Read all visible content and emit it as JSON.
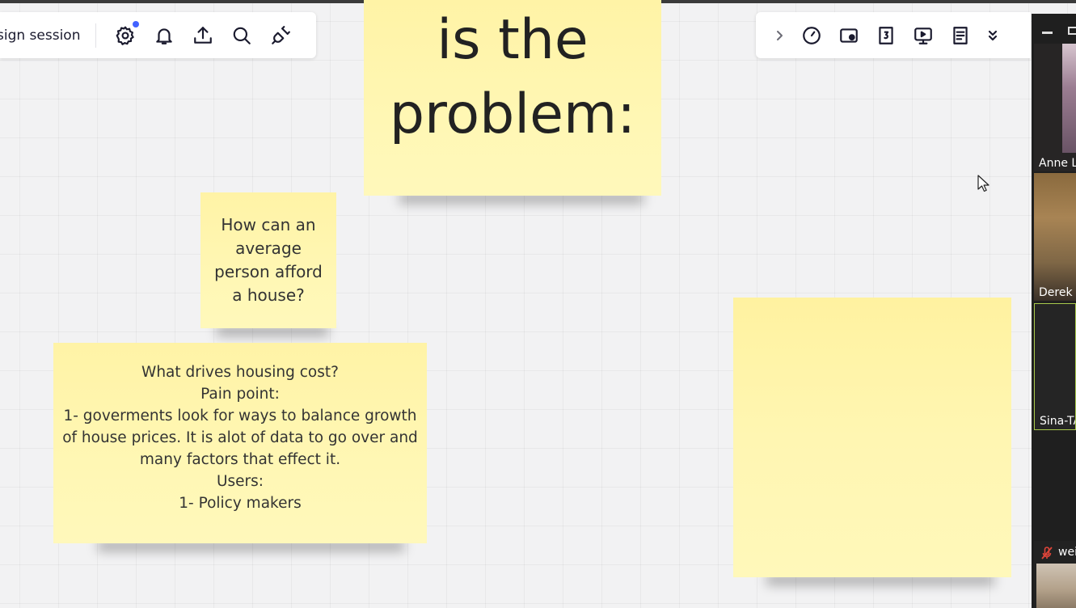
{
  "toolbar_left": {
    "session_label": "sign session",
    "icons": [
      "settings-icon",
      "bell-icon",
      "upload-icon",
      "search-icon",
      "plug-icon"
    ],
    "notification_dot_color": "#4262ff"
  },
  "toolbar_right": {
    "icons": [
      "chevron-right-icon",
      "timer-icon",
      "present-icon",
      "counter-icon",
      "screen-share-icon",
      "notes-icon",
      "chevrons-down-icon"
    ]
  },
  "stickies": {
    "title_lines": [
      "is the",
      "problem:"
    ],
    "question": "How can an average person afford a house?",
    "pain_lines": [
      "What drives housing cost?",
      "Pain point:",
      "1- goverments look for ways to balance growth",
      "of house prices. It is alot of data to go over and",
      "many factors that effect it.",
      "Users:",
      "1- Policy makers"
    ],
    "color": "#fff6b0"
  },
  "video_panel": {
    "participants": [
      {
        "name": "Anne L",
        "muted": false
      },
      {
        "name": "Derek",
        "muted": false
      },
      {
        "name": "Sina-TA",
        "muted": false,
        "active_speaker_color": "#a9c94c"
      },
      {
        "name": "wei",
        "muted": true
      }
    ]
  }
}
